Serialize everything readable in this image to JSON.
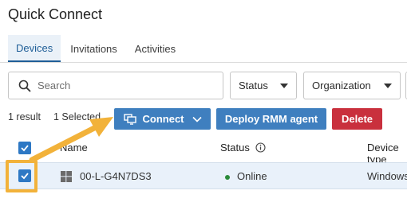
{
  "page_title": "Quick Connect",
  "tabs": [
    {
      "label": "Devices",
      "active": true
    },
    {
      "label": "Invitations",
      "active": false
    },
    {
      "label": "Activities",
      "active": false
    }
  ],
  "search": {
    "placeholder": "Search",
    "value": ""
  },
  "filters": {
    "status_label": "Status",
    "organization_label": "Organization"
  },
  "toolbar": {
    "result_count": "1 result",
    "selected_count": "1 Selected",
    "connect_label": "Connect",
    "deploy_label": "Deploy RMM agent",
    "delete_label": "Delete"
  },
  "table": {
    "columns": {
      "name": "Name",
      "status": "Status",
      "device_type": "Device type"
    },
    "rows": [
      {
        "name": "00-L-G4N7DS3",
        "status": "Online",
        "device_type": "Windows",
        "selected": true
      }
    ]
  },
  "colors": {
    "accent_blue": "#3f7fbf",
    "delete_red": "#c9303d",
    "highlight_orange": "#f2b23a",
    "online_green": "#2a8a3a"
  },
  "icons": [
    "search-icon",
    "monitor-icon",
    "chevron-down-icon",
    "info-icon",
    "windows-icon",
    "checkmark-icon",
    "arrow-annotation-icon"
  ]
}
